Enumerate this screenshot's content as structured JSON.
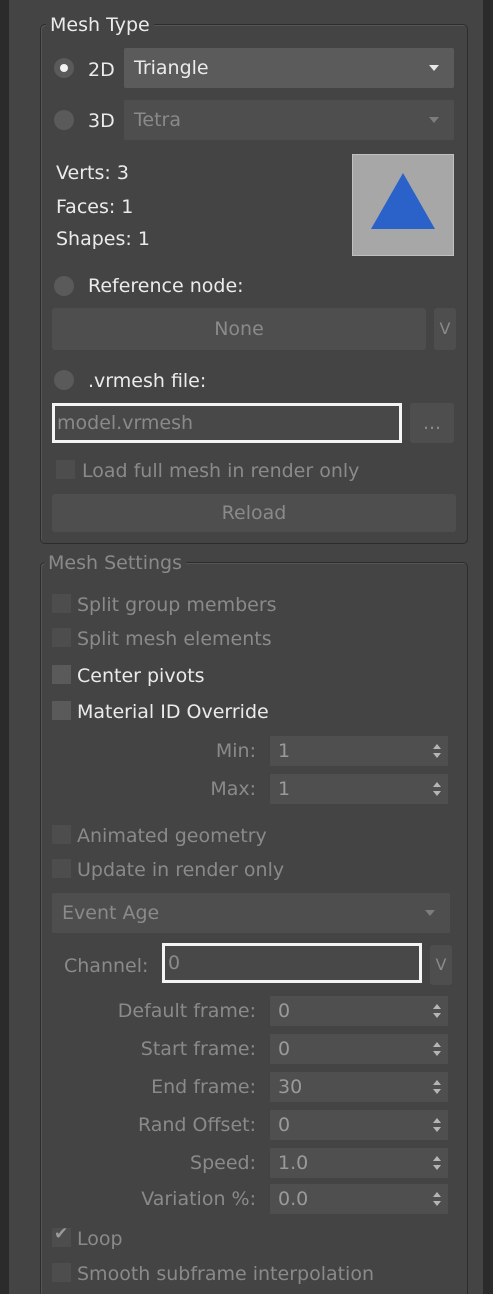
{
  "mesh_type": {
    "title": "Mesh Type",
    "option_2d": "2D",
    "option_2d_selected": true,
    "shape_2d_value": "Triangle",
    "option_3d": "3D",
    "shape_3d_value": "Tetra",
    "verts": "Verts: 3",
    "faces": "Faces: 1",
    "shapes": "Shapes: 1",
    "preview_color": "#2a62c9",
    "reference_node_label": "Reference node:",
    "reference_node_value": "None",
    "reference_pick_label": "V",
    "vrmesh_label": ".vrmesh file:",
    "vrmesh_placeholder": "model.vrmesh",
    "browse_label": "...",
    "load_full_mesh": "Load full mesh in render only",
    "reload": "Reload"
  },
  "mesh_settings": {
    "title": "Mesh Settings",
    "split_group_members": "Split group members",
    "split_mesh_elements": "Split mesh elements",
    "center_pivots": "Center pivots",
    "material_id_override": "Material ID Override",
    "min_label": "Min:",
    "min_value": "1",
    "max_label": "Max:",
    "max_value": "1",
    "animated_geometry": "Animated geometry",
    "update_in_render_only": "Update in render only",
    "event_dropdown": "Event Age",
    "channel_label": "Channel:",
    "channel_value": "0",
    "channel_pick_label": "V",
    "default_frame_label": "Default frame:",
    "default_frame_value": "0",
    "start_frame_label": "Start frame:",
    "start_frame_value": "0",
    "end_frame_label": "End frame:",
    "end_frame_value": "30",
    "rand_offset_label": "Rand Offset:",
    "rand_offset_value": "0",
    "speed_label": "Speed:",
    "speed_value": "1.0",
    "variation_label": "Variation %:",
    "variation_value": "0.0",
    "loop": "Loop",
    "loop_checked": true,
    "smooth_subframe": "Smooth subframe interpolation"
  },
  "colors": {
    "panel_bg": "#444444",
    "accent_white": "#f4f4f4"
  }
}
